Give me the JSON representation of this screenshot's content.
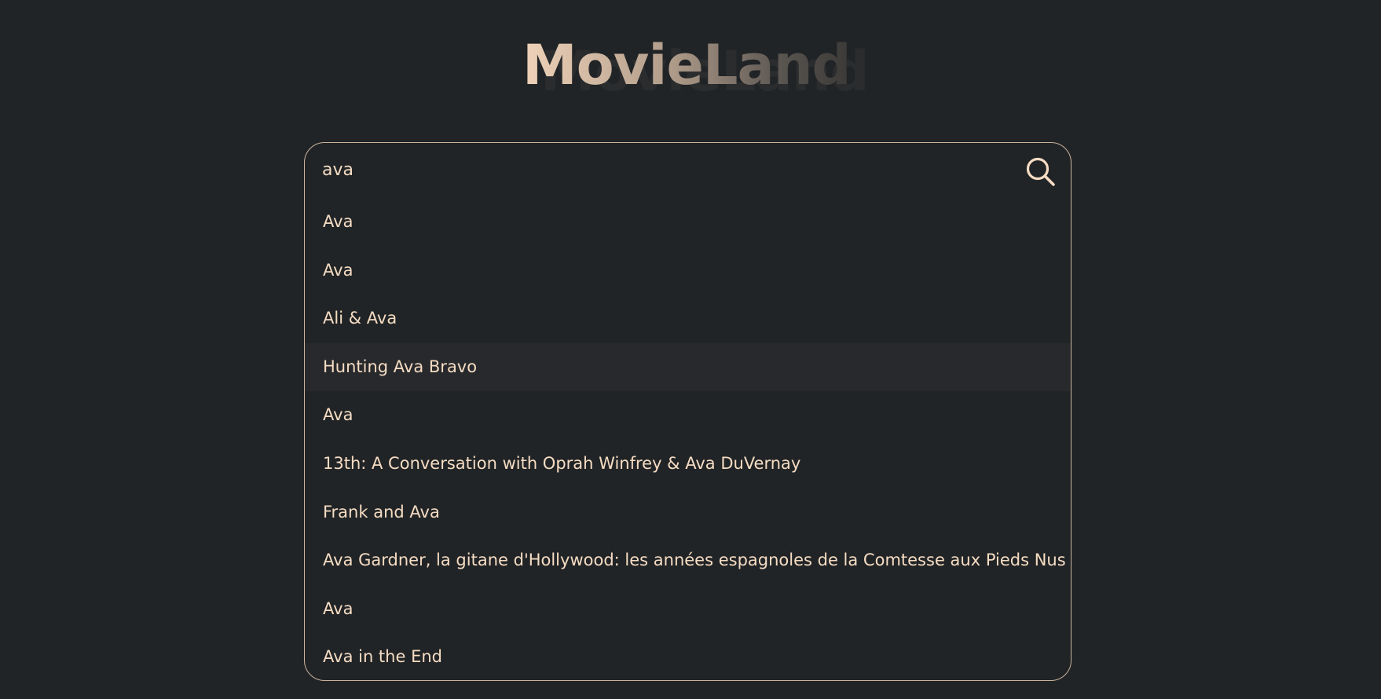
{
  "app": {
    "title": "MovieLand"
  },
  "search": {
    "value": "ava",
    "placeholder": ""
  },
  "suggestions": [
    {
      "label": "Ava",
      "active": false
    },
    {
      "label": "Ava",
      "active": false
    },
    {
      "label": "Ali & Ava",
      "active": false
    },
    {
      "label": "Hunting Ava Bravo",
      "active": true
    },
    {
      "label": "Ava",
      "active": false
    },
    {
      "label": "13th: A Conversation with Oprah Winfrey & Ava DuVernay",
      "active": false
    },
    {
      "label": "Frank and Ava",
      "active": false
    },
    {
      "label": "Ava Gardner, la gitane d'Hollywood: les années espagnoles de la Comtesse aux Pieds Nus",
      "active": false
    },
    {
      "label": "Ava",
      "active": false
    },
    {
      "label": "Ava in the End",
      "active": false
    }
  ],
  "colors": {
    "background": "#212426",
    "accent": "#f5dcc3",
    "border": "#c9b39f",
    "highlight": "#28292c"
  },
  "icons": {
    "search": "search-icon"
  }
}
